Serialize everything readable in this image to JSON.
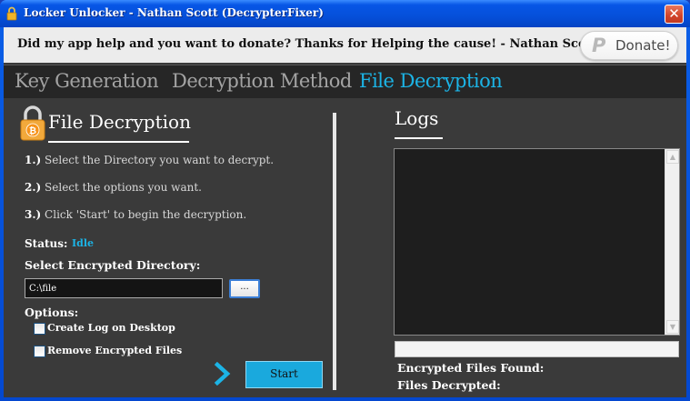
{
  "window": {
    "title": "Locker Unlocker - Nathan Scott (DecrypterFixer)",
    "close_label": "✕"
  },
  "banner": {
    "message": "Did my app help and you want to donate? Thanks for Helping the cause! - Nathan Scott",
    "donate_label": "Donate!",
    "donate_icon": "paypal-icon"
  },
  "tabs": [
    {
      "label": "Key Generation",
      "active": false
    },
    {
      "label": "Decryption Method",
      "active": false
    },
    {
      "label": "File Decryption",
      "active": true
    }
  ],
  "file_decryption": {
    "title": "File Decryption",
    "icon": "bitcoin-lock-icon",
    "steps": [
      {
        "num": "1.)",
        "text": "Select the Directory you want to decrypt."
      },
      {
        "num": "2.)",
        "text": "Select the options you want."
      },
      {
        "num": "3.)",
        "text": "Click 'Start' to begin the decryption."
      }
    ],
    "status_label": "Status:",
    "status_value": "Idle",
    "directory_label": "Select Encrypted Directory:",
    "directory_value": "C:\\file",
    "browse_label": "...",
    "options_label": "Options:",
    "options": [
      {
        "label": "Create Log on Desktop",
        "checked": false
      },
      {
        "label": "Remove Encrypted Files",
        "checked": false
      }
    ],
    "start_label": "Start"
  },
  "logs": {
    "title": "Logs",
    "content": "",
    "progress": 0,
    "encrypted_found_label": "Encrypted Files Found:",
    "files_decrypted_label": "Files Decrypted:"
  },
  "colors": {
    "accent": "#1cb4e6",
    "panel_bg": "#3a3a3a",
    "tab_bar_bg": "#262626",
    "start_button": "#1aa9dd"
  }
}
